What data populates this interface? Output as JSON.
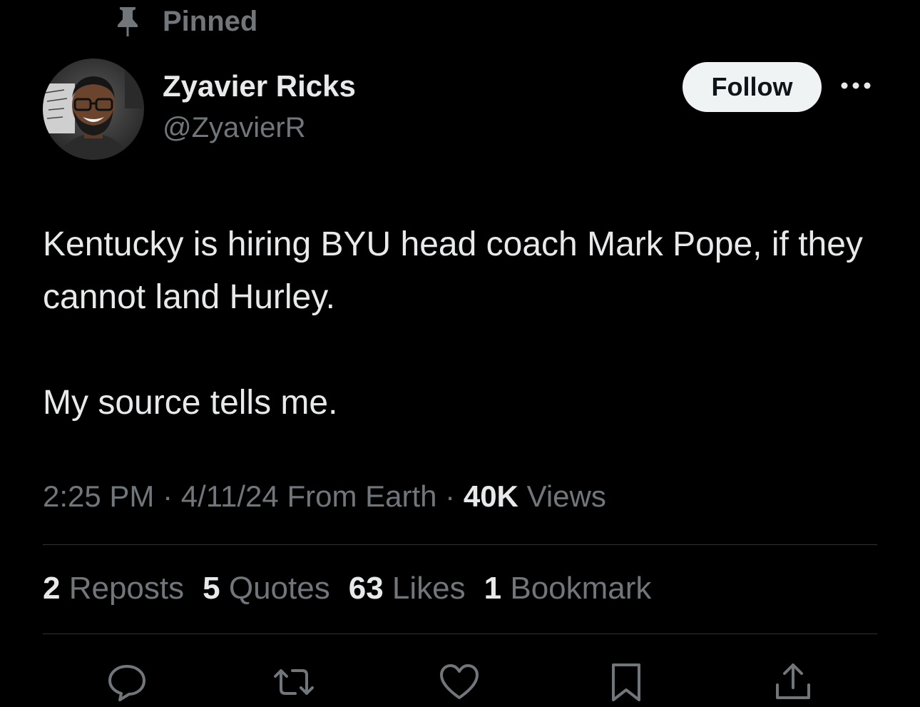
{
  "pinned": {
    "label": "Pinned",
    "icon": "pin-icon"
  },
  "author": {
    "name": "Zyavier Ricks",
    "handle": "@ZyavierR",
    "avatar_icon": "avatar-photo"
  },
  "follow_label": "Follow",
  "more_icon": "more-dots-icon",
  "tweet": {
    "text": "Kentucky is hiring BYU head coach Mark Pope, if they cannot land Hurley.\n\nMy source tells me."
  },
  "meta": {
    "time": "2:25 PM",
    "sep1": "·",
    "date": "4/11/24",
    "location": "From Earth",
    "sep2": "·",
    "views_count": "40K",
    "views_label": "Views"
  },
  "stats": [
    {
      "count": "2",
      "label": "Reposts"
    },
    {
      "count": "5",
      "label": "Quotes"
    },
    {
      "count": "63",
      "label": "Likes"
    },
    {
      "count": "1",
      "label": "Bookmark"
    }
  ],
  "actions": [
    {
      "icon": "reply-icon"
    },
    {
      "icon": "repost-icon"
    },
    {
      "icon": "like-icon"
    },
    {
      "icon": "bookmark-icon"
    },
    {
      "icon": "share-icon"
    }
  ],
  "colors": {
    "background": "#000000",
    "primary_text": "#e7e9ea",
    "secondary_text": "#71767b",
    "divider": "#2f3336",
    "follow_bg": "#eff3f4"
  }
}
